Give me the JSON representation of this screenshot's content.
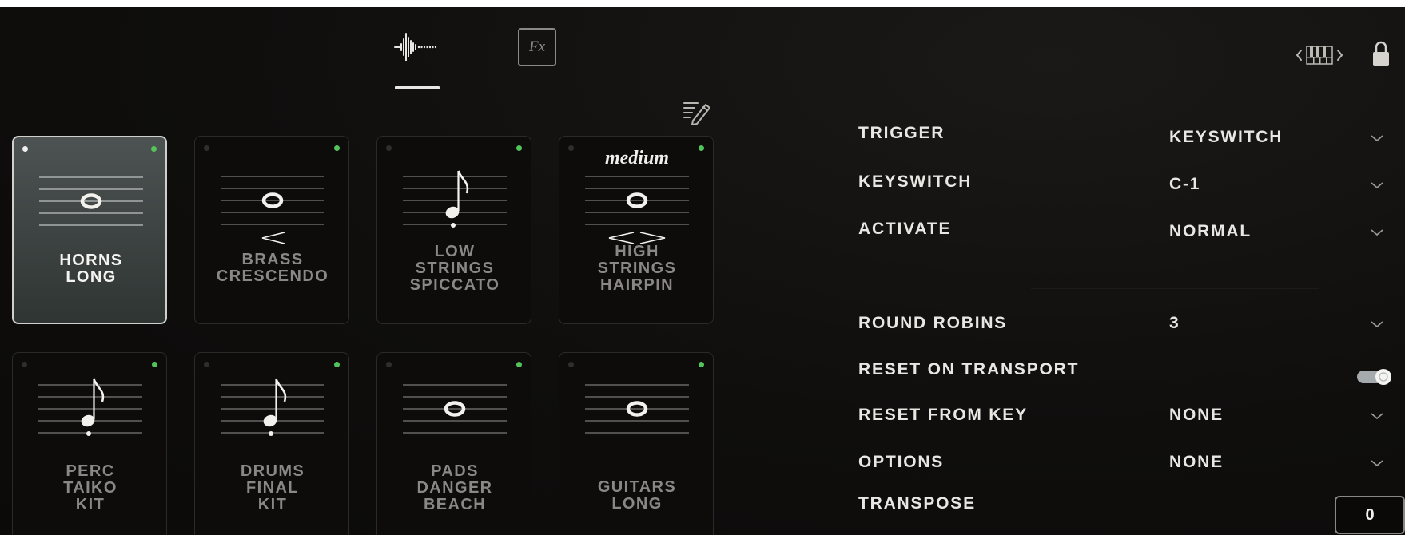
{
  "tabs": [
    {
      "name": "waveform-icon",
      "active": true
    },
    {
      "label": "Fx",
      "name": "fx-icon",
      "active": false
    }
  ],
  "header_icons": [
    "piano-keyboard-icon",
    "lock-icon",
    "edit-list-icon"
  ],
  "tiles": [
    {
      "lines": [
        "HORNS",
        "LONG"
      ],
      "selected": true,
      "notation": "whole",
      "dynamic": ""
    },
    {
      "lines": [
        "BRASS",
        "CRESCENDO"
      ],
      "selected": false,
      "notation": "whole-cresc",
      "dynamic": ""
    },
    {
      "lines": [
        "LOW",
        "STRINGS",
        "SPICCATO"
      ],
      "selected": false,
      "notation": "eighth-staccato",
      "dynamic": ""
    },
    {
      "lines": [
        "HIGH",
        "STRINGS",
        "HAIRPIN"
      ],
      "selected": false,
      "notation": "whole-hairpin",
      "dynamic": "medium"
    },
    {
      "lines": [
        "PERC",
        "TAIKO",
        "KIT"
      ],
      "selected": false,
      "notation": "eighth-staccato",
      "dynamic": ""
    },
    {
      "lines": [
        "DRUMS",
        "FINAL",
        "KIT"
      ],
      "selected": false,
      "notation": "eighth-staccato",
      "dynamic": ""
    },
    {
      "lines": [
        "PADS",
        "DANGER",
        "BEACH"
      ],
      "selected": false,
      "notation": "whole",
      "dynamic": ""
    },
    {
      "lines": [
        "GUITARS",
        "LONG"
      ],
      "selected": false,
      "notation": "whole",
      "dynamic": ""
    }
  ],
  "settings": {
    "trigger": {
      "label": "TRIGGER",
      "value": "KEYSWITCH"
    },
    "keyswitch": {
      "label": "KEYSWITCH",
      "value": "C-1"
    },
    "activate": {
      "label": "ACTIVATE",
      "value": "NORMAL"
    },
    "round_robins": {
      "label": "ROUND ROBINS",
      "value": "3"
    },
    "reset_on_transport": {
      "label": "RESET ON TRANSPORT",
      "enabled": true
    },
    "reset_from_key": {
      "label": "RESET FROM KEY",
      "value": "NONE"
    },
    "options": {
      "label": "OPTIONS",
      "value": "NONE"
    },
    "transpose": {
      "label": "TRANSPOSE",
      "value": "0"
    }
  },
  "colors": {
    "background": "#0f0e0d",
    "tile_selected": "#3f4544",
    "led_active": "#53c45a",
    "text": "#e9e7e3",
    "text_muted": "#8a8784"
  }
}
